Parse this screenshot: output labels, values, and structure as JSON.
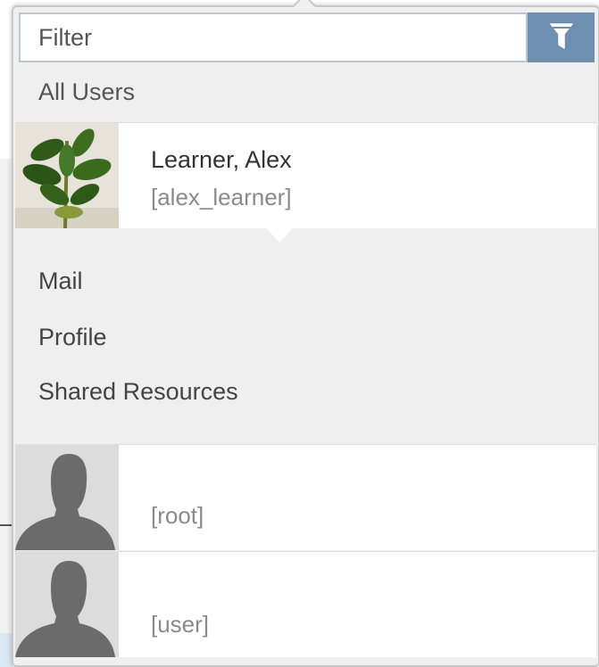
{
  "filter": {
    "placeholder": "Filter",
    "button_icon": "funnel-icon"
  },
  "all_users_label": "All Users",
  "selected_user": {
    "name": "Learner, Alex",
    "login": "[alex_learner]",
    "avatar": "plant-photo"
  },
  "menu": {
    "items": [
      {
        "label": "Mail"
      },
      {
        "label": "Profile"
      },
      {
        "label": "Shared Resources"
      }
    ]
  },
  "users": [
    {
      "name": "",
      "login": "[root]",
      "avatar": "person-silhouette-icon"
    },
    {
      "name": "",
      "login": "[user]",
      "avatar": "person-silhouette-icon"
    }
  ],
  "colors": {
    "accent": "#6f8fb0",
    "panel_bg": "#efefef",
    "card_bg": "#ffffff"
  }
}
